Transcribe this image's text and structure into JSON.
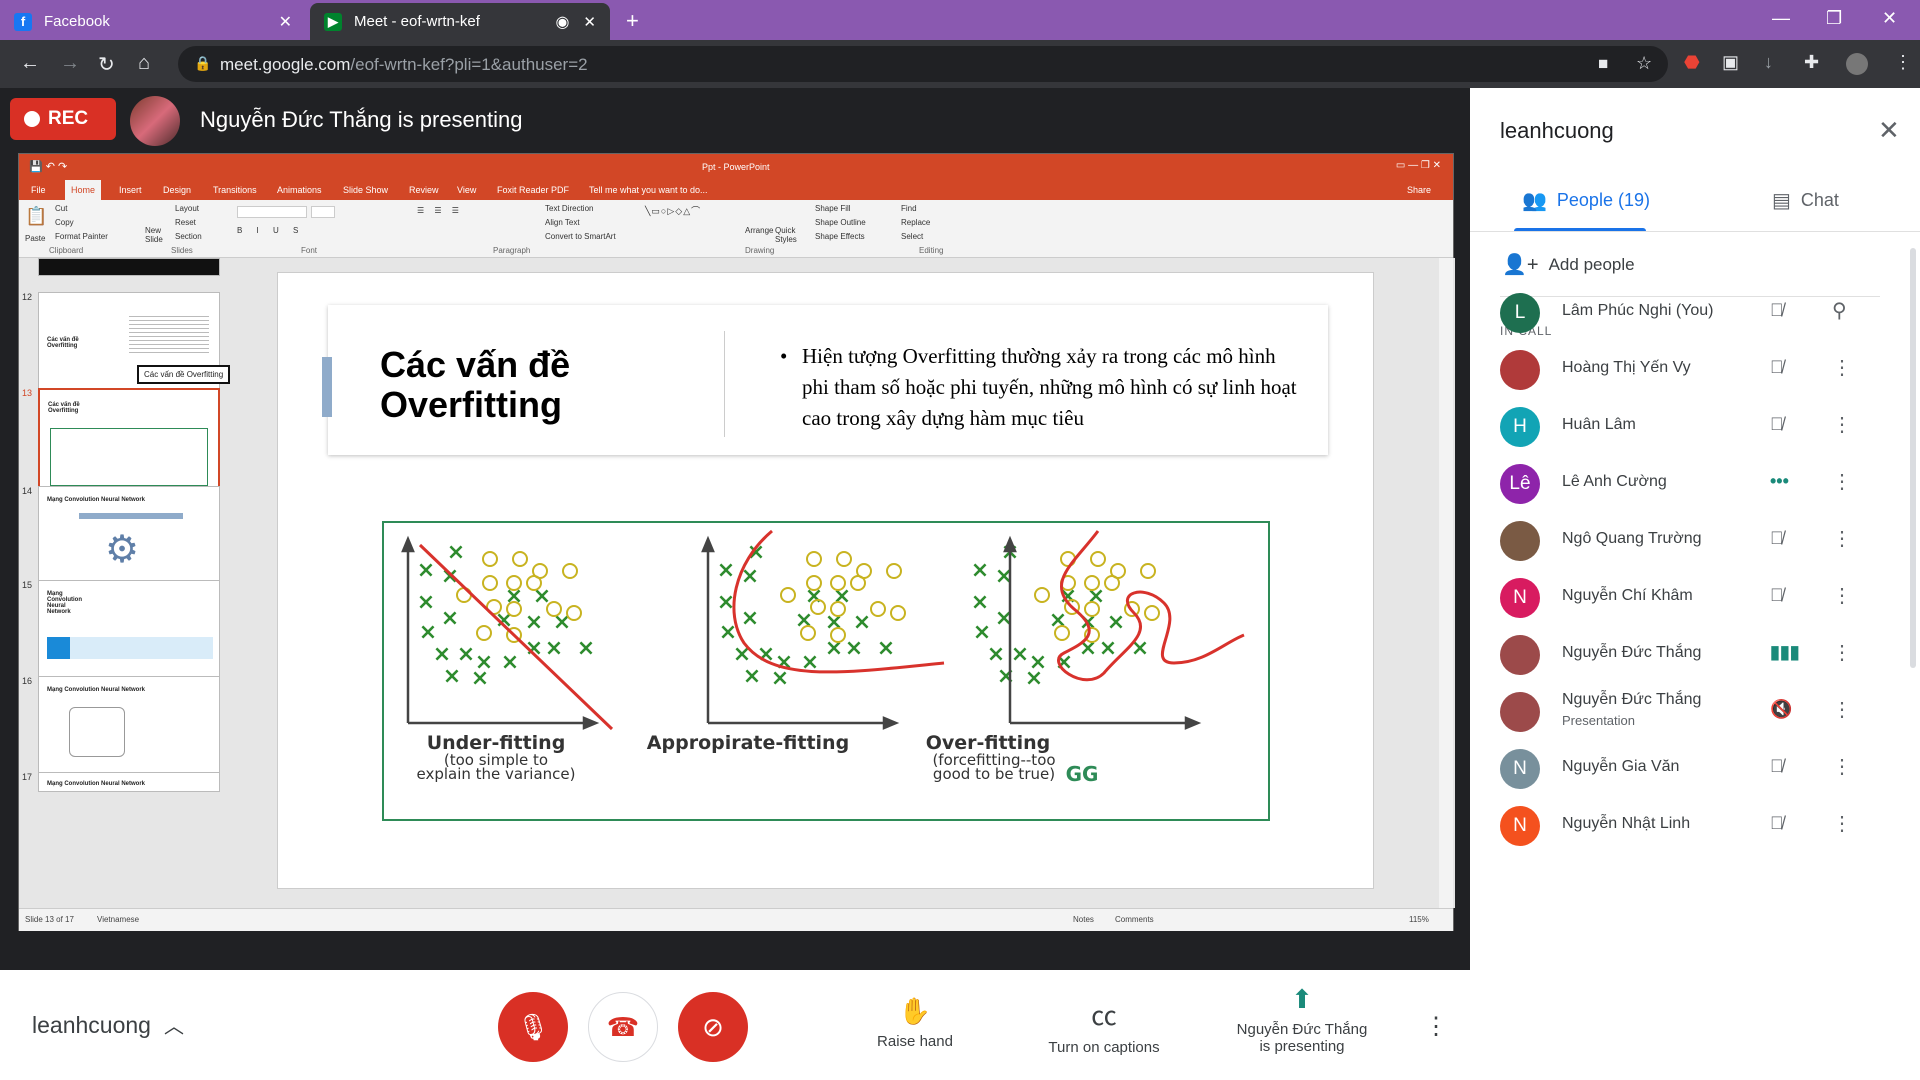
{
  "browser": {
    "tabs": [
      {
        "title": "Facebook",
        "favicon": "facebook-icon"
      },
      {
        "title": "Meet - eof-wrtn-kef",
        "favicon": "google-meet-icon"
      }
    ],
    "url_host": "meet.google.com",
    "url_path": "/eof-wrtn-kef?pli=1&authuser=2"
  },
  "meet": {
    "rec_label": "REC",
    "presenting_text": "Nguyễn Đức Thắng is presenting",
    "meeting_id": "leanhcuong",
    "actions": {
      "raise_hand": "Raise hand",
      "captions": "Turn on captions",
      "presenting_line1": "Nguyễn Đức Thắng",
      "presenting_line2": "is presenting"
    }
  },
  "powerpoint": {
    "window_title": "Ppt - PowerPoint",
    "ribbon_tabs": [
      "File",
      "Home",
      "Insert",
      "Design",
      "Transitions",
      "Animations",
      "Slide Show",
      "Review",
      "View",
      "Foxit Reader PDF",
      "Tell me what you want to do..."
    ],
    "share": "Share",
    "ribbon_groups": [
      "Clipboard",
      "Slides",
      "Font",
      "Paragraph",
      "Drawing",
      "Editing"
    ],
    "ribbon_items": {
      "paste": "Paste",
      "cut": "Cut",
      "copy": "Copy",
      "format_painter": "Format Painter",
      "new_slide": "New Slide",
      "layout": "Layout",
      "reset": "Reset",
      "section": "Section",
      "text_direction": "Text Direction",
      "align_text": "Align Text",
      "smartart": "Convert to SmartArt",
      "arrange": "Arrange",
      "quick_styles": "Quick Styles",
      "shape_fill": "Shape Fill",
      "shape_outline": "Shape Outline",
      "shape_effects": "Shape Effects",
      "find": "Find",
      "replace": "Replace",
      "select": "Select"
    },
    "thumbnails": [
      {
        "num": "12",
        "title": "Các vấn đề Overfitting",
        "tooltip": "Các vấn đề Overfitting"
      },
      {
        "num": "13",
        "title": "Các vấn đề Overfitting"
      },
      {
        "num": "14",
        "title": "Mạng Convolution Neural Network"
      },
      {
        "num": "15",
        "title": "Mạng Convolution Neural Network"
      },
      {
        "num": "16",
        "title": "Mạng Convolution Neural Network"
      },
      {
        "num": "17",
        "title": "Mạng Convolution Neural Network"
      }
    ],
    "slide": {
      "title": "Các vấn đề Overfitting",
      "bullet": "Hiện tượng Overfitting thường xảy ra trong các mô hình phi tham số hoặc phi tuyến, những mô hình có sự linh hoạt cao trong xây dựng hàm mục tiêu",
      "figure": {
        "panels": [
          {
            "label": "Under-fitting",
            "sub1": "(too simple to",
            "sub2": "explain the variance)"
          },
          {
            "label": "Appropirate-fitting"
          },
          {
            "label": "Over-fitting",
            "sub1": "(forcefitting--too",
            "sub2": "good to be true)"
          }
        ],
        "logo": "GG"
      }
    },
    "status": {
      "slide_count": "Slide 13 of 17",
      "language": "Vietnamese",
      "notes": "Notes",
      "comments": "Comments",
      "zoom": "115%"
    }
  },
  "panel": {
    "title": "leanhcuong",
    "people_tab": "People (19)",
    "chat_tab": "Chat",
    "add_people": "Add people",
    "in_call": "IN CALL",
    "people": [
      {
        "name": "Lâm Phúc Nghi (You)",
        "initial": "L",
        "color": "#1e6f50",
        "status": "mic-off",
        "action": "pin"
      },
      {
        "name": "Hoàng Thị Yến Vy",
        "initial": "",
        "color": "#b03a3a",
        "status": "mic-off",
        "action": "more"
      },
      {
        "name": "Huân Lâm",
        "initial": "H",
        "color": "#12a4b5",
        "status": "mic-off",
        "action": "more"
      },
      {
        "name": "Lê Anh Cường",
        "initial": "Lê",
        "color": "#8e24aa",
        "status": "speaking-dots",
        "action": "more"
      },
      {
        "name": "Ngô Quang Trường",
        "initial": "",
        "color": "#7a5a44",
        "status": "mic-off",
        "action": "more"
      },
      {
        "name": "Nguyễn Chí Khâm",
        "initial": "N",
        "color": "#d81b60",
        "status": "mic-off",
        "action": "more"
      },
      {
        "name": "Nguyễn Đức Thắng",
        "initial": "",
        "color": "#9c4a4a",
        "status": "speaking",
        "action": "more"
      },
      {
        "name": "Nguyễn Đức Thắng",
        "sub": "Presentation",
        "initial": "",
        "color": "#9c4a4a",
        "status": "audio-off",
        "action": "more"
      },
      {
        "name": "Nguyễn Gia Văn",
        "initial": "N",
        "color": "#78909c",
        "status": "mic-off",
        "action": "more"
      },
      {
        "name": "Nguyễn Nhật Linh",
        "initial": "N",
        "color": "#f4511e",
        "status": "mic-off",
        "action": "more"
      }
    ]
  },
  "colors": {
    "accent": "#1a73e8",
    "rec": "#d93025",
    "tab_strip": "#8a59b0",
    "ppt": "#d24726"
  }
}
